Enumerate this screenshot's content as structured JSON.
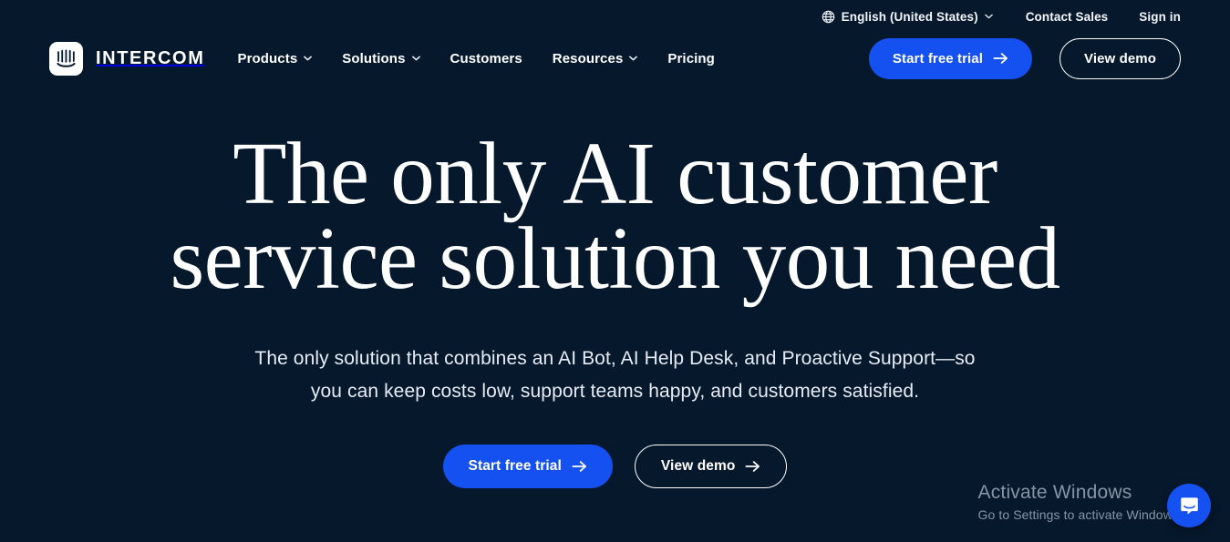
{
  "theme": {
    "background": "#06182C",
    "accent_blue": "#1550F0",
    "text_primary": "#FFFFFF",
    "text_muted": "#E6ECF4",
    "watermark_gray": "#8794A6"
  },
  "utility_bar": {
    "language": {
      "icon": "globe-icon",
      "label": "English (United States)",
      "chevron": "chevron-down-icon"
    },
    "contact_sales": "Contact Sales",
    "sign_in": "Sign in"
  },
  "navbar": {
    "brand": {
      "logo_icon": "intercom-logo-icon",
      "name": "INTERCOM"
    },
    "links": [
      {
        "label": "Products",
        "has_dropdown": true
      },
      {
        "label": "Solutions",
        "has_dropdown": true
      },
      {
        "label": "Customers",
        "has_dropdown": false
      },
      {
        "label": "Resources",
        "has_dropdown": true
      },
      {
        "label": "Pricing",
        "has_dropdown": false
      }
    ],
    "actions": {
      "primary": {
        "label": "Start free trial",
        "icon": "arrow-right-icon"
      },
      "secondary": {
        "label": "View demo"
      }
    }
  },
  "hero": {
    "title_line1": "The only AI customer",
    "title_line2": "service solution you need",
    "subtitle": "The only solution that combines an AI Bot, AI Help Desk, and Proactive Support—so you can keep costs low, support teams happy, and customers satisfied.",
    "actions": {
      "primary": {
        "label": "Start free trial",
        "icon": "arrow-right-icon"
      },
      "secondary": {
        "label": "View demo",
        "icon": "arrow-right-icon"
      }
    }
  },
  "watermark": {
    "title": "Activate Windows",
    "subtitle": "Go to Settings to activate Windows."
  },
  "chat_launcher": {
    "icon": "intercom-chat-icon",
    "color": "#1550F0"
  }
}
